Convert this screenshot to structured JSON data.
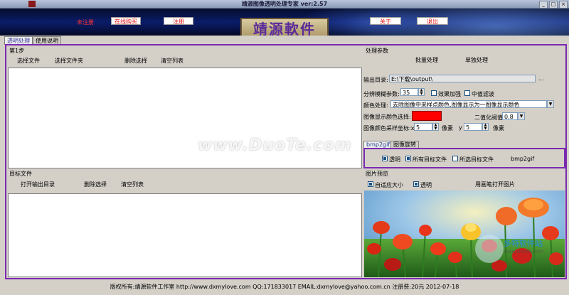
{
  "window": {
    "title": "靖源图像透明处理专家 ver:2.57",
    "controls": [
      "_",
      "□",
      "×"
    ]
  },
  "banner": {
    "unregistered": "未注册",
    "buy_online": "在线购买",
    "register": "注册",
    "logo": "靖源軟件",
    "about": "关于",
    "exit": "退出"
  },
  "tabs": [
    "透明处理",
    "使用说明"
  ],
  "step1": {
    "header": "第1步",
    "buttons": [
      "选择文件",
      "选择文件夹",
      "删除选择",
      "清空列表"
    ]
  },
  "target": {
    "header": "目标文件",
    "buttons": [
      "打开输出目录",
      "删除选择",
      "清空列表"
    ]
  },
  "params": {
    "header": "处理参数",
    "batch": "批量处理",
    "single": "单独处理",
    "output_label": "输出目录:",
    "output_value": "E:\\下载\\output\\",
    "browse": "...",
    "blur_label": "分辨模糊参数:",
    "blur_value": "35",
    "effect_enhance": "效果加强",
    "median_filter": "中值滤波",
    "color_label": "颜色处理:",
    "color_value": "去除图像中采样点颜色,图像显示为一图像显示颜色",
    "display_color_label": "图像显示颜色选择:",
    "display_color": "#ff0000",
    "threshold_label": "二值化阀值",
    "threshold_value": "0.8",
    "sample_label": "图像颜色采样坐标:x",
    "sample_x": "5",
    "px1": "像素",
    "y_label": "y",
    "sample_y": "5",
    "px2": "像素"
  },
  "subtabs": [
    "bmp2gif",
    "图像旋转"
  ],
  "bmp2gif": {
    "transparent": "透明",
    "all_targets": "所有目标文件",
    "selected_targets": "所选目标文件",
    "button": "bmp2gif"
  },
  "preview": {
    "header": "图片预览",
    "auto_fit": "自适应大小",
    "transparent": "透明",
    "open_with_paint": "用画笔打开图片"
  },
  "watermark": {
    "text": "www.DuoTe.com",
    "brand": "多特软件站",
    "site": "www.duote.com"
  },
  "statusbar": "版权所有:靖源软件工作室 http://www.dxmylove.com QQ:171833017 EMAIL:dxmylove@yahoo.com.cn 注册费:20元 2012-07-18"
}
